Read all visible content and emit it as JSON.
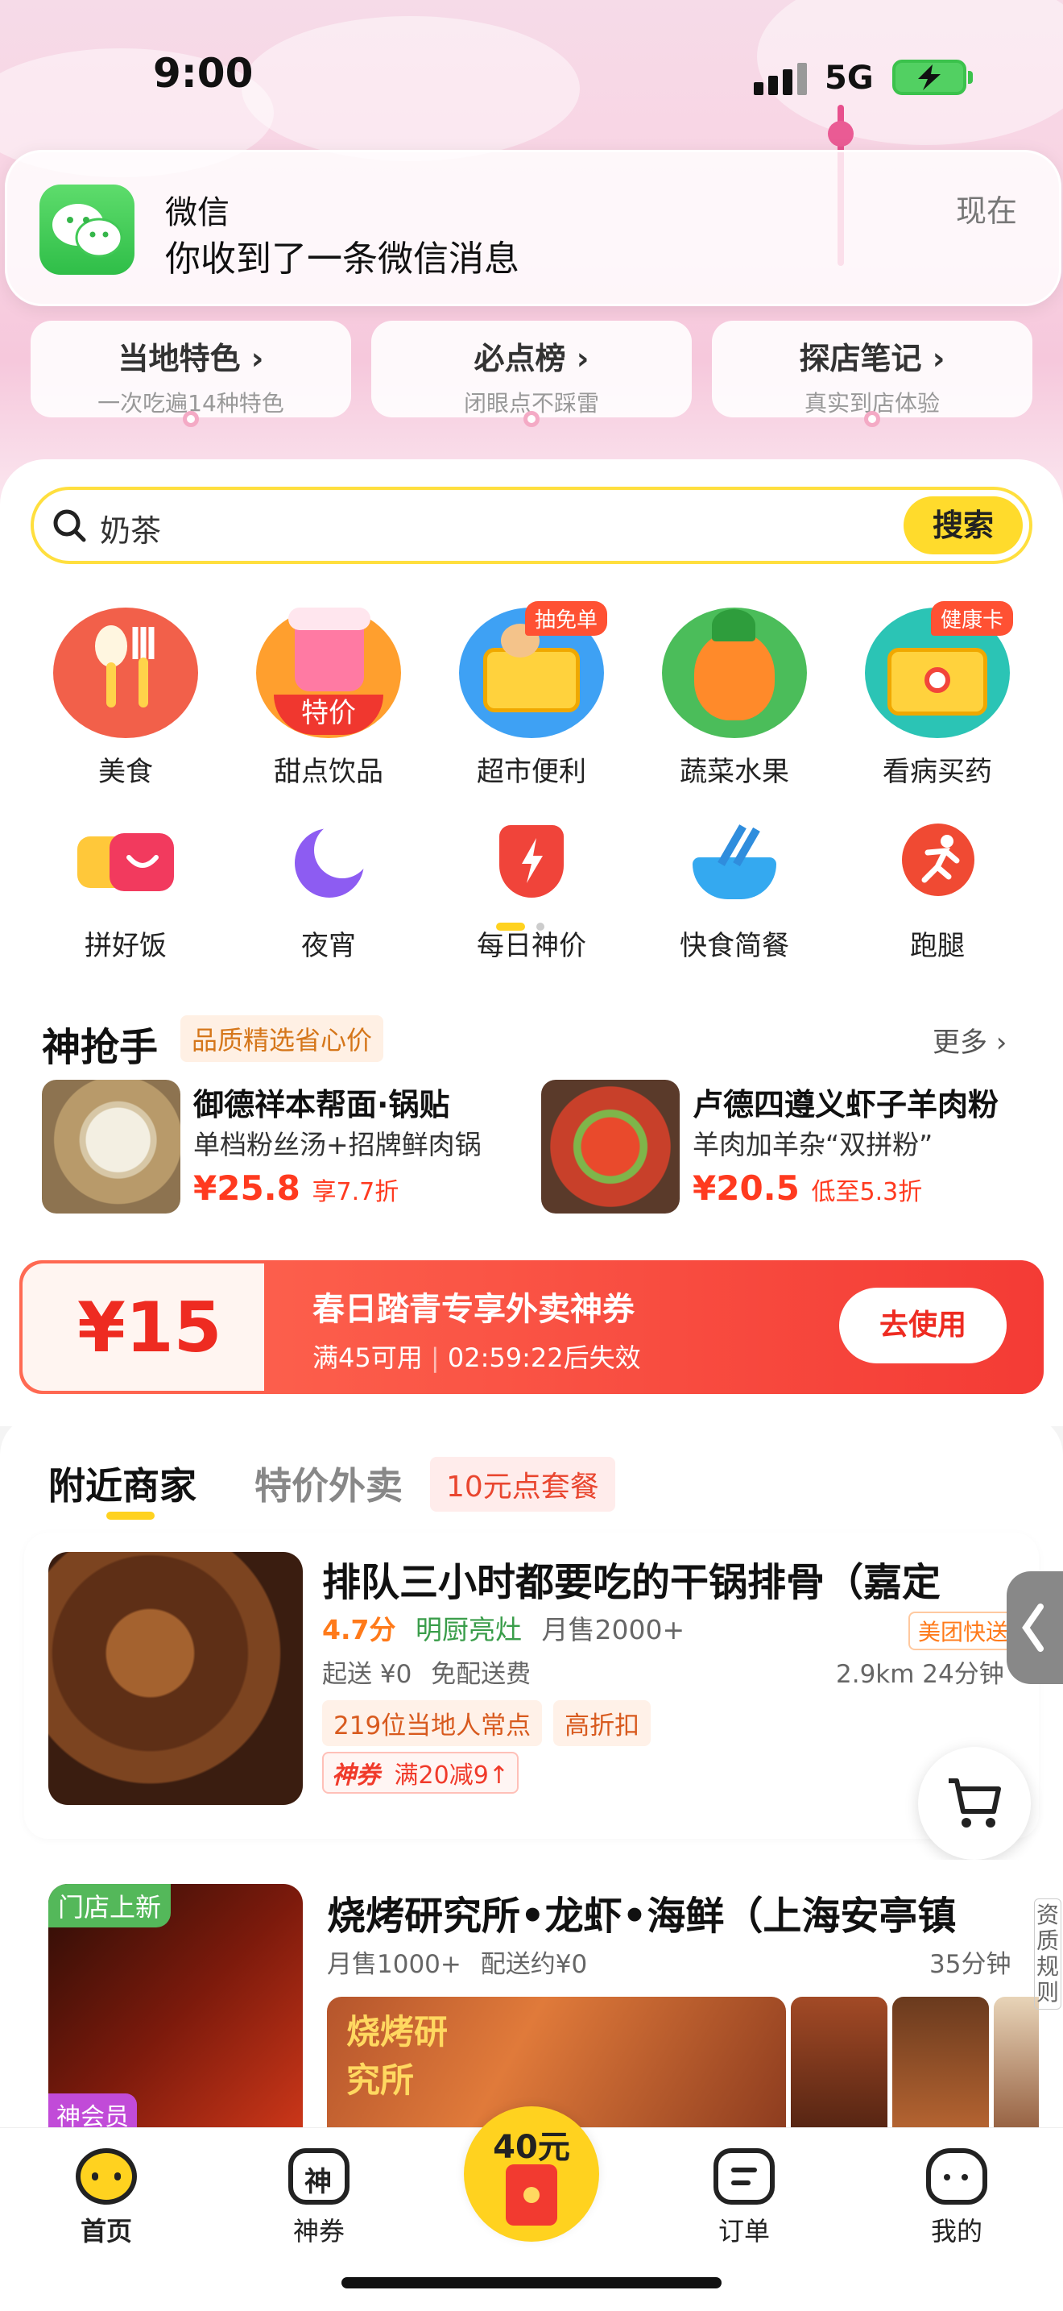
{
  "status_bar": {
    "time": "9:00",
    "network": "5G"
  },
  "notification": {
    "app": "微信",
    "message": "你收到了一条微信消息",
    "time": "现在"
  },
  "top_pills": [
    {
      "title": "当地特色 ›",
      "subtitle": "一次吃遍14种特色"
    },
    {
      "title": "必点榜 ›",
      "subtitle": "闭眼点不踩雷"
    },
    {
      "title": "探店笔记 ›",
      "subtitle": "真实到店体验"
    }
  ],
  "search": {
    "value": "奶茶",
    "button": "搜索"
  },
  "categories_row1": [
    {
      "label": "美食",
      "color": "#f2604a",
      "tag": ""
    },
    {
      "label": "甜点饮品",
      "color": "#ff9f2e",
      "tag": "特价"
    },
    {
      "label": "超市便利",
      "color": "#3ea1f4",
      "tag": "抽免单"
    },
    {
      "label": "蔬菜水果",
      "color": "#4bbd5a",
      "tag": ""
    },
    {
      "label": "看病买药",
      "color": "#2bc4b5",
      "tag": "健康卡"
    }
  ],
  "categories_row2": [
    {
      "label": "拼好饭",
      "color": "#f23a5e"
    },
    {
      "label": "夜宵",
      "color": "#8d5cf2"
    },
    {
      "label": "每日神价",
      "color": "#f0443a"
    },
    {
      "label": "快食简餐",
      "color": "#34a9f0"
    },
    {
      "label": "跑腿",
      "color": "#f04a33"
    }
  ],
  "deals": {
    "title": "神抢手",
    "subtitle": "品质精选省心价",
    "more": "更多 ›",
    "items": [
      {
        "name": "御德祥本帮面·锅贴",
        "desc": "单档粉丝汤+招牌鲜肉锅",
        "price": "¥25.8",
        "discount": "享7.7折"
      },
      {
        "name": "卢德四遵义虾子羊肉粉",
        "desc": "羊肉加羊杂“双拼粉”",
        "price": "¥20.5",
        "discount": "低至5.3折"
      }
    ]
  },
  "coupon": {
    "amount": "¥15",
    "title": "春日踏青专享外卖神券",
    "condition": "满45可用",
    "expiry": "02:59:22后失效",
    "button": "去使用"
  },
  "tabs": {
    "nearby": "附近商家",
    "special": "特价外卖",
    "combo": "10元点套餐"
  },
  "stores": [
    {
      "name": "排队三小时都要吃的干锅排骨（嘉定",
      "rating": "4.7分",
      "kitchen": "明厨亮灶",
      "sales": "月售2000+",
      "delivery_badge": "美团快送",
      "min_order": "起送 ¥0",
      "delivery_fee": "免配送费",
      "distance_time": "2.9km 24分钟",
      "tags": [
        "219位当地人常点",
        "高折扣"
      ],
      "coupon_label": "神券",
      "coupon_text": "满20减9↑"
    },
    {
      "name": "烧烤研究所•龙虾•海鲜（上海安亭镇",
      "new_badge": "门店上新",
      "sales": "月售1000+",
      "delivery_fee": "配送约¥0",
      "time": "35分钟",
      "image_text": "烧烤研究所",
      "member_label": "神会员"
    }
  ],
  "side_label": "资质规则",
  "bottom_nav": [
    {
      "label": "首页"
    },
    {
      "label": "神券"
    },
    {
      "label": "40元",
      "center": true
    },
    {
      "label": "订单"
    },
    {
      "label": "我的"
    }
  ]
}
